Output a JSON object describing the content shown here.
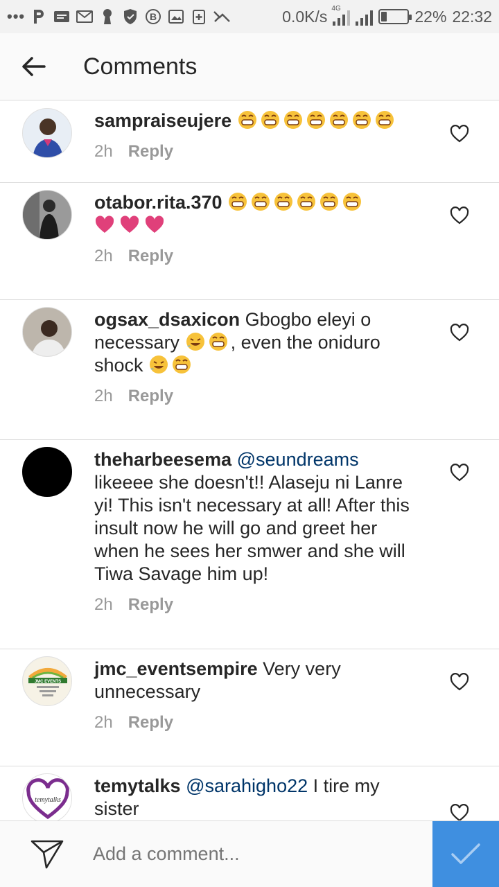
{
  "status_bar": {
    "dots": "•••",
    "icons": [
      "p-app-icon",
      "message-icon",
      "gmail-icon",
      "keyhole-icon",
      "shield-icon",
      "b-coin-icon",
      "gallery-icon",
      "medic-icon",
      "broken-icon"
    ],
    "speed": "0.0K/s",
    "network": "4G",
    "battery": "22%",
    "battery_level": 0.22,
    "time": "22:32"
  },
  "header": {
    "title": "Comments"
  },
  "comments": [
    {
      "username": "sampraiseujere",
      "mention": "",
      "text": "",
      "laugh_emojis": 7,
      "hearts": 0,
      "tail": "",
      "time": "2h",
      "reply": "Reply",
      "avatar": "photo-man-blue-suit"
    },
    {
      "username": "otabor.rita.370",
      "mention": "",
      "text": "",
      "laugh_emojis": 6,
      "hearts": 3,
      "tail": "",
      "time": "2h",
      "reply": "Reply",
      "avatar": "photo-man-dark"
    },
    {
      "username": "ogsax_dsaxicon",
      "mention": "",
      "text_parts": [
        "Gbogbo eleyi o necessary",
        ", even the oniduro shock"
      ],
      "time": "2h",
      "reply": "Reply",
      "avatar": "photo-man-bald"
    },
    {
      "username": "theharbeesema",
      "mention": "@seundreams",
      "text": "likeeee she doesn't!! Alaseju ni Lanre yi! This isn't necessary at all! After this insult now he will go and greet her when he sees her smwer and she will Tiwa Savage him up!",
      "time": "2h",
      "reply": "Reply",
      "avatar": "black-circle"
    },
    {
      "username": "jmc_eventsempire",
      "mention": "",
      "text": "Very very unnecessary",
      "time": "2h",
      "reply": "Reply",
      "avatar": "logo-jmc-events"
    },
    {
      "username": "temytalks",
      "mention": "@sarahigho22",
      "text": "I tire my sister",
      "time": "",
      "reply": "",
      "avatar": "logo-temytalks"
    }
  ],
  "composer": {
    "placeholder": "Add a comment..."
  },
  "colors": {
    "accent": "#3f8fe0",
    "mention": "#003569",
    "meta": "#999999",
    "heart_pink": "#e0407a",
    "emoji_yellow": "#f7c23a"
  }
}
